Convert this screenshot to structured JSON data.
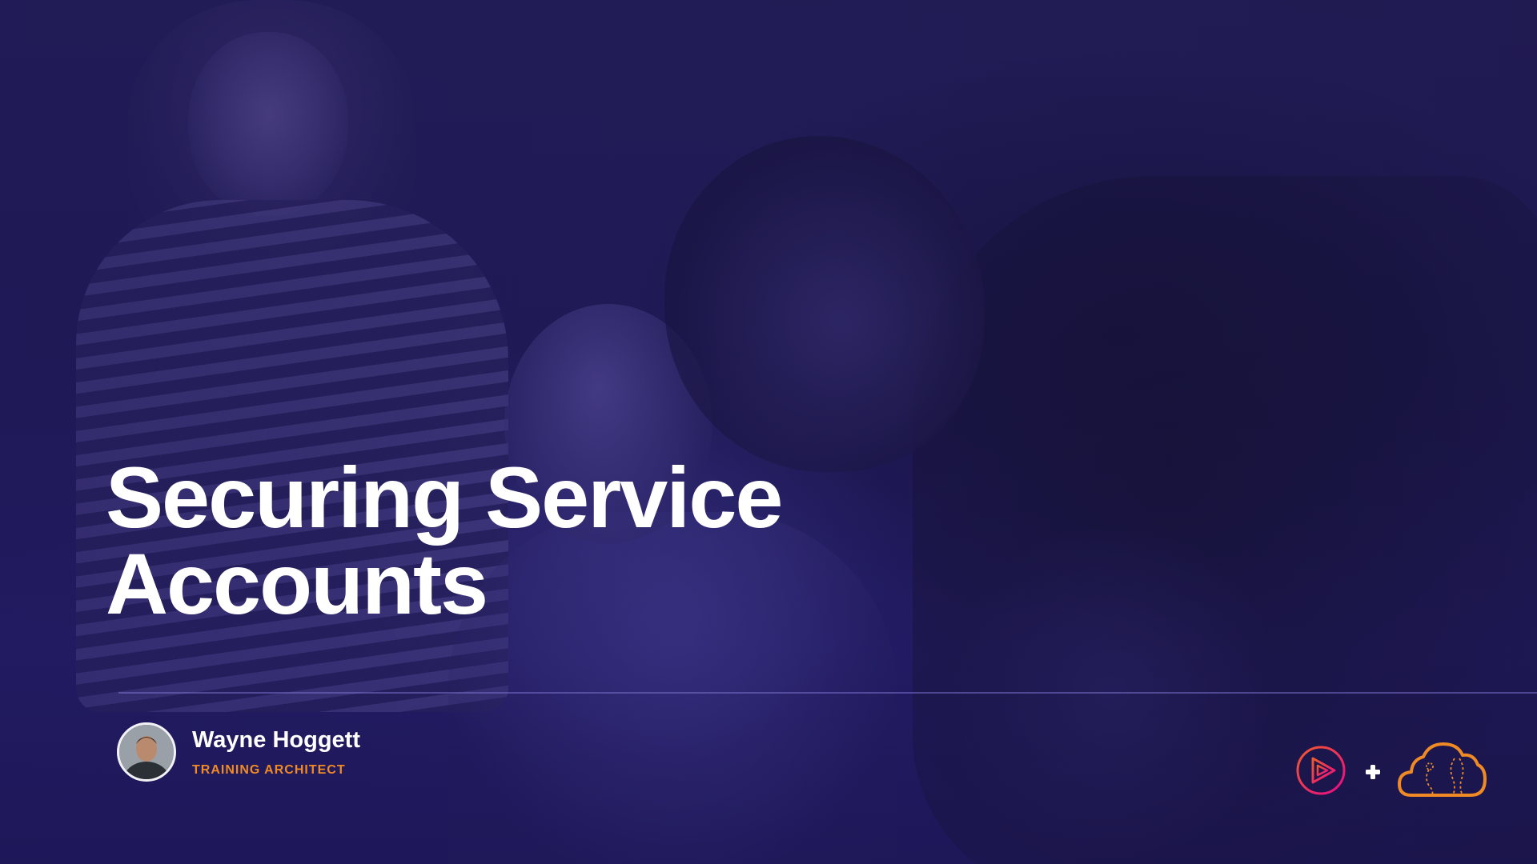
{
  "slide": {
    "title_line1": "Securing Service",
    "title_line2": "Accounts"
  },
  "author": {
    "name": "Wayne Hoggett",
    "role": "TRAINING ARCHITECT"
  },
  "logos": {
    "left": "pluralsight-play-icon",
    "separator": "plus-icon",
    "right": "acloudguru-cloud-icon"
  },
  "colors": {
    "background": "#221d55",
    "title": "#ffffff",
    "accent_orange": "#f08a24",
    "accent_pink": "#e8205c"
  }
}
